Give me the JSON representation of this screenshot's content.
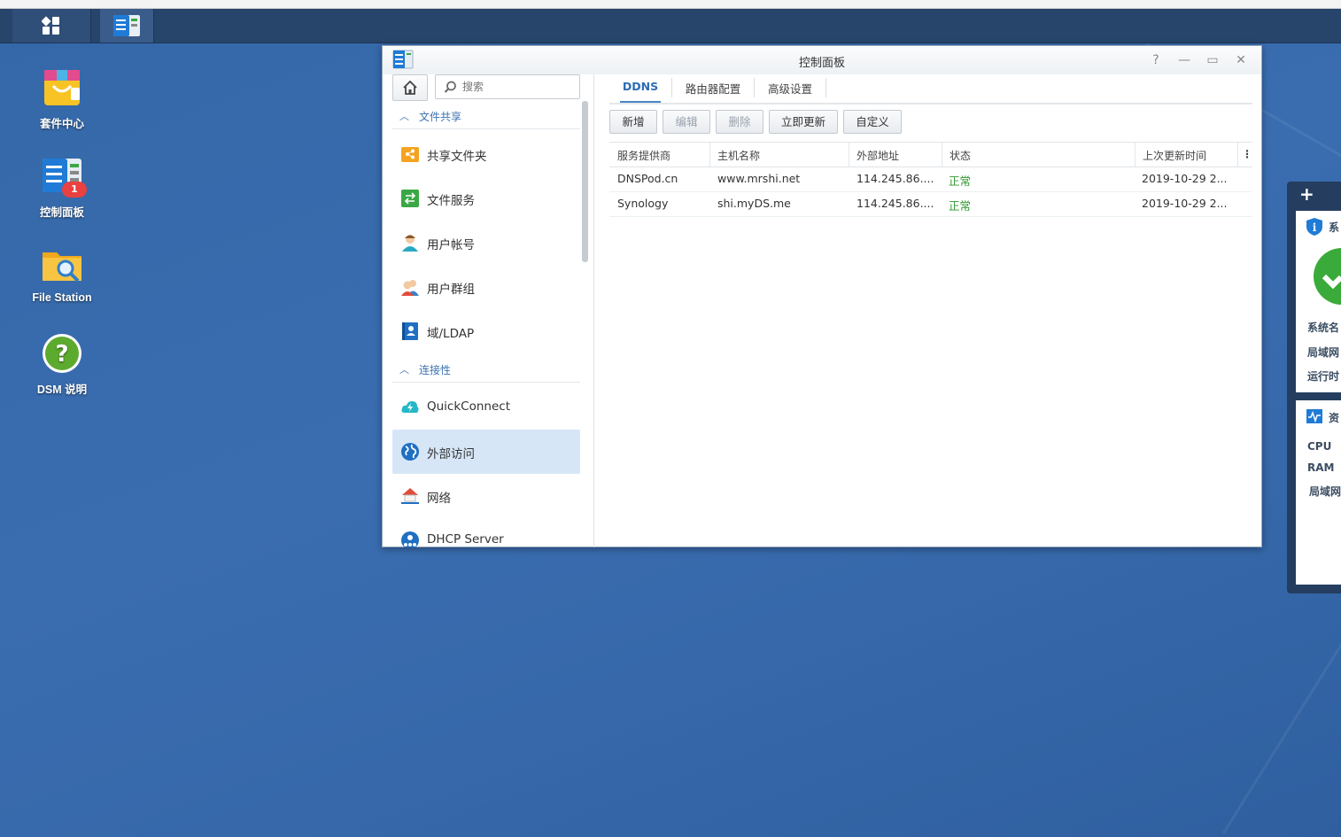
{
  "taskbar": {
    "main_menu_icon": "grid-icon",
    "app_icon": "control-panel-icon"
  },
  "desktop": {
    "icons": [
      {
        "label": "套件中心",
        "icon": "package-center-icon"
      },
      {
        "label": "控制面板",
        "icon": "control-panel-icon",
        "badge": "1"
      },
      {
        "label": "File Station",
        "icon": "file-station-icon"
      },
      {
        "label": "DSM 说明",
        "icon": "help-icon"
      }
    ]
  },
  "window": {
    "title": "控制面板",
    "controls": {
      "help": "?",
      "minimize": "—",
      "maximize": "▭",
      "close": "✕"
    }
  },
  "sidebar": {
    "search_placeholder": "搜索",
    "sections": [
      {
        "title": "文件共享"
      },
      {
        "title": "连接性"
      }
    ],
    "items": [
      {
        "label": "共享文件夹",
        "icon": "shared-folder-icon"
      },
      {
        "label": "文件服务",
        "icon": "file-services-icon"
      },
      {
        "label": "用户帐号",
        "icon": "user-icon"
      },
      {
        "label": "用户群组",
        "icon": "group-icon"
      },
      {
        "label": "域/LDAP",
        "icon": "ldap-icon"
      },
      {
        "label": "QuickConnect",
        "icon": "quickconnect-icon"
      },
      {
        "label": "外部访问",
        "icon": "external-access-icon",
        "selected": true
      },
      {
        "label": "网络",
        "icon": "network-icon"
      },
      {
        "label": "DHCP Server",
        "icon": "dhcp-icon"
      }
    ]
  },
  "tabs": [
    {
      "label": "DDNS",
      "active": true
    },
    {
      "label": "路由器配置"
    },
    {
      "label": "高级设置"
    }
  ],
  "toolbar": {
    "add": "新增",
    "edit": "编辑",
    "delete": "删除",
    "update_now": "立即更新",
    "customize": "自定义"
  },
  "table": {
    "columns": [
      "服务提供商",
      "主机名称",
      "外部地址",
      "状态",
      "上次更新时间"
    ],
    "rows": [
      {
        "provider": "DNSPod.cn",
        "hostname": "www.mrshi.net",
        "address": "114.245.86....",
        "status": "正常",
        "updated": "2019-10-29 2..."
      },
      {
        "provider": "Synology",
        "hostname": "shi.myDS.me",
        "address": "114.245.86....",
        "status": "正常",
        "updated": "2019-10-29 2..."
      }
    ]
  },
  "widget": {
    "add": "+",
    "system_title": "系",
    "sys_labels": [
      "系统名",
      "局域网",
      "运行时"
    ],
    "resource_title": "资",
    "res_labels": [
      "CPU",
      "RAM",
      "局域网"
    ]
  },
  "colors": {
    "desktop": "#3b6aa8",
    "taskbar": "#27446a",
    "accent": "#2d6cb5",
    "selected_row": "#d6e6f7",
    "status_ok": "#2e9a2e"
  }
}
